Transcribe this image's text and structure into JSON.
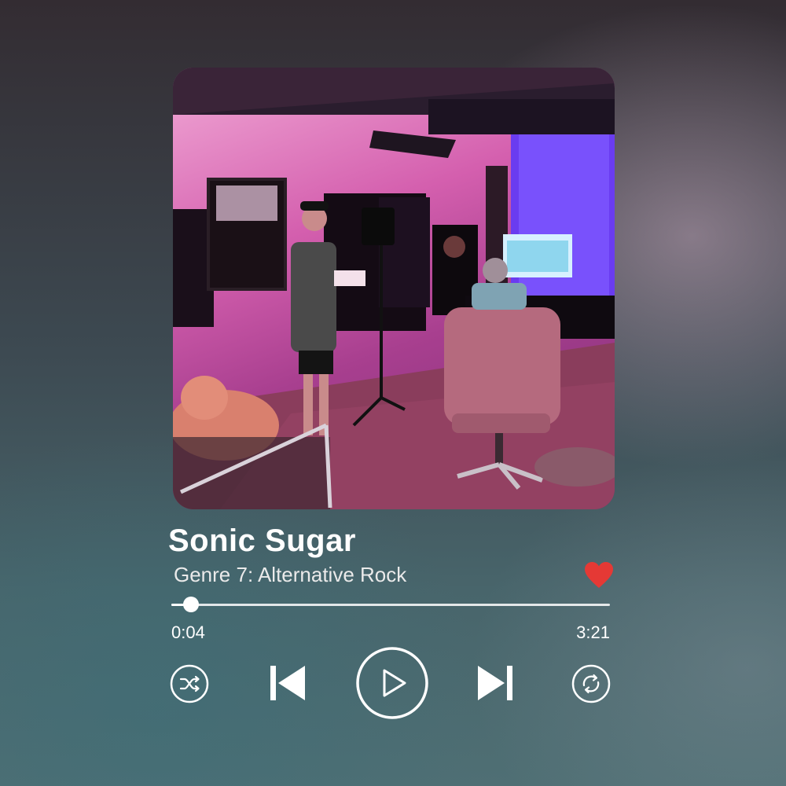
{
  "album_art": {
    "icon": "album-cover-image"
  },
  "track": {
    "title": "Sonic Sugar",
    "subtitle": "Genre 7: Alternative Rock",
    "liked": true
  },
  "playback": {
    "current_time": "0:04",
    "total_time": "3:21",
    "progress_fraction": 0.045
  },
  "controls": {
    "shuffle_icon": "shuffle-icon",
    "previous_icon": "skip-previous-icon",
    "play_icon": "play-icon",
    "next_icon": "skip-next-icon",
    "repeat_icon": "repeat-icon"
  },
  "colors": {
    "accent_heart": "#e53935",
    "foreground": "#ffffff"
  }
}
